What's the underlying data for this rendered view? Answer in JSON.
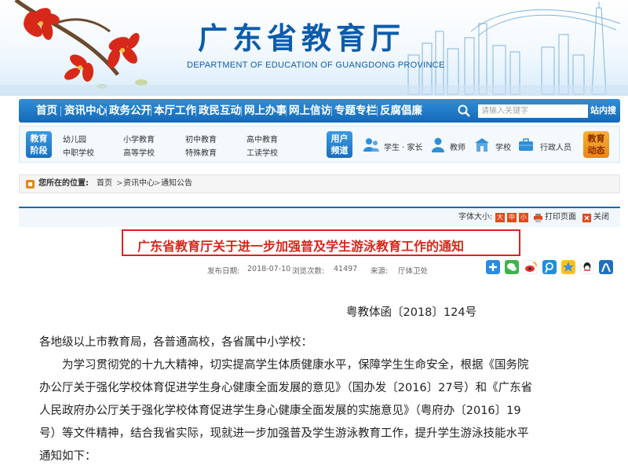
{
  "header": {
    "title": "广东省教育厅",
    "subtitle": "DEPARTMENT OF EDUCATION OF GUANGDONG PROVINCE"
  },
  "nav": {
    "items": [
      "首页",
      "资讯中心",
      "政务公开",
      "本厅工作",
      "政民互动",
      "网上办事",
      "网上信访",
      "专题专栏",
      "反腐倡廉"
    ],
    "search_placeholder": "请输入关键字",
    "search_button": "站内搜索"
  },
  "stage": {
    "badge": [
      "教育",
      "阶段"
    ],
    "links_row1": [
      "幼儿园",
      "小学教育",
      "初中教育",
      "高中教育"
    ],
    "links_row2": [
      "中职学校",
      "高等学校",
      "特殊教育",
      "工读学校"
    ],
    "user_badge": [
      "用户",
      "频道"
    ],
    "users": [
      "学生 · 家长",
      "教师",
      "学校",
      "行政人员"
    ],
    "news_badge": [
      "教育",
      "动态"
    ]
  },
  "breadcrumb": {
    "label": "您所在的位置:",
    "items": [
      "首页",
      "资讯中心",
      "通知公告"
    ],
    "sep": ">"
  },
  "tools": {
    "font_label": "字体大小:",
    "sizes": [
      "大",
      "中",
      "小"
    ],
    "print": "打印页面",
    "close": "关闭"
  },
  "article": {
    "title": "广东省教育厅关于进一步加强普及学生游泳教育工作的通知",
    "date_label": "发布日期:",
    "date": "2018-07-10",
    "views_label": "浏览次数:",
    "views": "41497",
    "source_label": "来源:",
    "source": "厅体卫处",
    "doc_no": "粤教体函〔2018〕124号",
    "lines": [
      "各地级以上市教育局，各普通高校，各省属中小学校：",
      "　　为学习贯彻党的十九大精神，切实提高学生体质健康水平，保障学生生命安全，根据《国务院",
      "办公厅关于强化学校体育促进学生身心健康全面发展的意见》（国办发〔2016〕27号）和《广东省",
      "人民政府办公厅关于强化学校体育促进学生身心健康全面发展的实施意见》（粤府办〔2016〕19",
      "号）等文件精神，结合我省实际，现就进一步加强普及学生游泳教育工作，提升学生游泳技能水平",
      "通知如下："
    ]
  },
  "colors": {
    "nav_blue": "#1569b8",
    "title_red": "#d5281b",
    "accent_orange": "#e8871a"
  }
}
